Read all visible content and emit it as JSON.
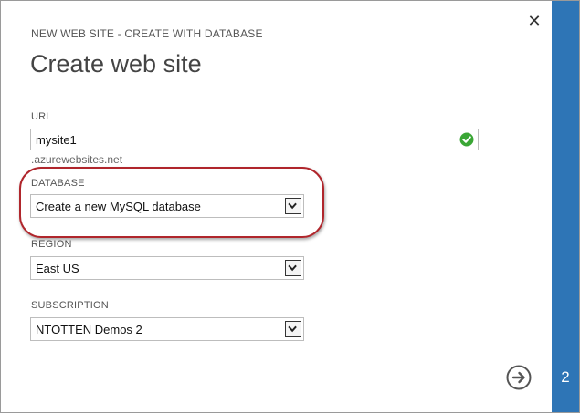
{
  "dialog": {
    "subtitle": "NEW WEB SITE - CREATE WITH DATABASE",
    "title": "Create web site",
    "close_icon": "close-icon",
    "step_number": "2"
  },
  "form": {
    "url": {
      "label": "URL",
      "value": "mysite1",
      "suffix": ".azurewebsites.net",
      "status_icon": "check-circle-icon",
      "status_color": "#3aa635"
    },
    "database": {
      "label": "DATABASE",
      "selected": "Create a new MySQL database"
    },
    "region": {
      "label": "REGION",
      "selected": "East US"
    },
    "subscription": {
      "label": "SUBSCRIPTION",
      "selected": "NTOTTEN Demos 2"
    }
  },
  "colors": {
    "step_bar": "#2e75b6",
    "highlight_ring": "#b0262c"
  },
  "next_icon": "arrow-right-circle-icon"
}
